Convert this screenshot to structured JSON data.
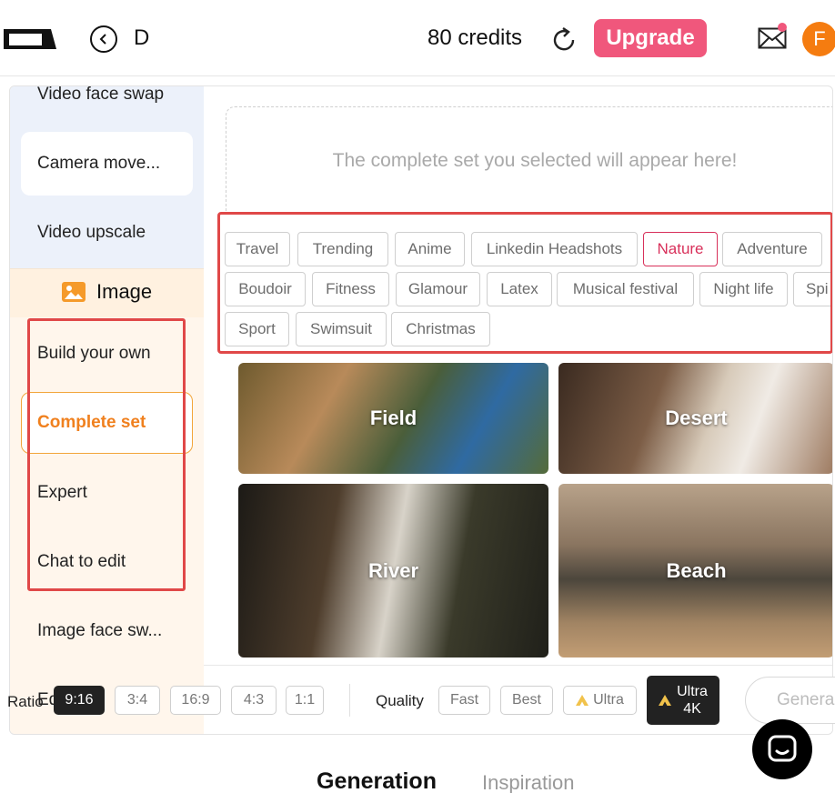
{
  "header": {
    "project_name": "D",
    "credits": "80 credits",
    "upgrade_label": "Upgrade",
    "avatar_initial": "F"
  },
  "sidebar": {
    "video_items": [
      "Video face swap",
      "Camera move...",
      "Video upscale"
    ],
    "image_title": "Image",
    "image_items": [
      "Build your own",
      "Complete set",
      "Expert",
      "Chat to edit",
      "Image face sw..."
    ],
    "partial_item": "Ed"
  },
  "main": {
    "placeholder": "The complete set you selected will appear here!",
    "tags": [
      "Travel",
      "Trending",
      "Anime",
      "Linkedin Headshots",
      "Nature",
      "Adventure",
      "Boudoir",
      "Fitness",
      "Glamour",
      "Latex",
      "Musical festival",
      "Night life",
      "Spi",
      "Sport",
      "Swimsuit",
      "Christmas"
    ],
    "selected_tag": "Nature",
    "tiles": [
      "Field",
      "Desert",
      "River",
      "Beach"
    ]
  },
  "toolbar": {
    "ratio_label": "Ratio",
    "ratios": [
      "9:16",
      "3:4",
      "16:9",
      "4:3",
      "1:1"
    ],
    "selected_ratio": "9:16",
    "quality_label": "Quality",
    "qualities": [
      "Fast",
      "Best",
      "Ultra"
    ],
    "ultra4k_line1": "Ultra",
    "ultra4k_line2": "4K",
    "generate_label": "Genera"
  },
  "tabs": {
    "generation": "Generation",
    "inspiration": "Inspiration"
  },
  "colors": {
    "accent_pink": "#f0577c",
    "accent_orange": "#f0801e",
    "highlight_red": "#e04848"
  }
}
